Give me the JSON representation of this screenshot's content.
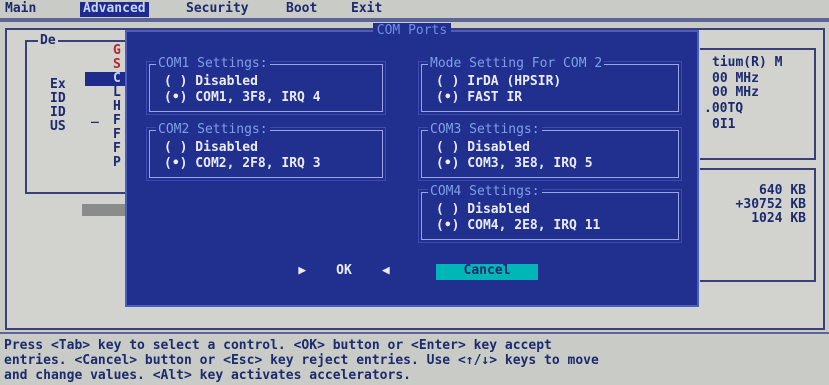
{
  "menubar": {
    "items": [
      "Main",
      "Advanced",
      "Security",
      "Boot",
      "Exit"
    ]
  },
  "background": {
    "left_label": "De",
    "left_rows": [
      "Ex",
      "ID",
      "ID",
      "US"
    ],
    "red_letters": [
      "G",
      "S"
    ],
    "menu_letters": [
      "C",
      "L",
      "H",
      "F",
      "F",
      "F",
      "P"
    ],
    "dash": "_",
    "right_info": [
      "tium(R) M",
      "00 MHz",
      "00 MHz",
      ".00TQ",
      "0I1"
    ],
    "memory": [
      "640 KB",
      "+30752 KB",
      "1024 KB"
    ]
  },
  "dialog": {
    "title": "COM Ports",
    "com1": {
      "title": "COM1 Settings:",
      "options": [
        "( ) Disabled",
        "(•) COM1, 3F8, IRQ 4"
      ]
    },
    "com2": {
      "title": "COM2 Settings:",
      "options": [
        "( ) Disabled",
        "(•) COM2, 2F8, IRQ 3"
      ]
    },
    "mode": {
      "title": "Mode Setting For COM 2",
      "options": [
        "( ) IrDA (HPSIR)",
        "(•) FAST IR"
      ]
    },
    "com3": {
      "title": "COM3 Settings:",
      "options": [
        "( ) Disabled",
        "(•) COM3, 3E8, IRQ 5"
      ]
    },
    "com4": {
      "title": "COM4 Settings:",
      "options": [
        "( ) Disabled",
        "(•) COM4, 2E8, IRQ 11"
      ]
    },
    "ok_label": "OK",
    "ok_left_arrow": "▶",
    "ok_right_arrow": "◀",
    "cancel_label": "Cancel"
  },
  "status": {
    "lines": [
      "Press <Tab> key to select a control. <OK> button or <Enter> key accept",
      "entries. <Cancel> button or <Esc> key reject entries. Use <↑/↓> keys to move",
      "and change values. <Alt> key activates accelerators."
    ]
  }
}
